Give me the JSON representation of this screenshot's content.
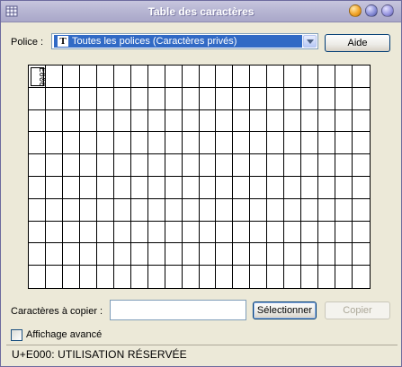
{
  "window": {
    "title": "Table des caractères",
    "accent_color": "#316ac5"
  },
  "font_picker": {
    "label": "Police :",
    "selected": "Toutes les polices (Caractères privés)",
    "icon": "truetype-font-icon",
    "icon_glyph": "T"
  },
  "buttons": {
    "help": "Aide",
    "select": "Sélectionner",
    "copy": "Copier"
  },
  "grid": {
    "columns": 20,
    "rows": 10,
    "selected_cell_glyph": "E000"
  },
  "copy_field": {
    "label": "Caractères à copier :",
    "value": ""
  },
  "advanced_view": {
    "label": "Affichage avancé",
    "checked": false
  },
  "status": {
    "text": "U+E000: UTILISATION RÉSERVÉE"
  }
}
